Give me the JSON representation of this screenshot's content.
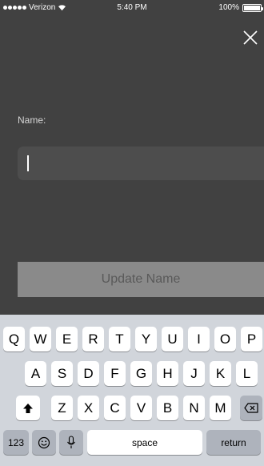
{
  "status_bar": {
    "carrier": "Verizon",
    "time": "5:40 PM",
    "battery": "100%",
    "battery_level": 1.0
  },
  "form": {
    "name_label": "Name:",
    "name_value": "",
    "submit_label": "Update Name"
  },
  "keyboard": {
    "row1": [
      "Q",
      "W",
      "E",
      "R",
      "T",
      "Y",
      "U",
      "I",
      "O",
      "P"
    ],
    "row2": [
      "A",
      "S",
      "D",
      "F",
      "G",
      "H",
      "J",
      "K",
      "L"
    ],
    "row3": [
      "Z",
      "X",
      "C",
      "V",
      "B",
      "N",
      "M"
    ],
    "numbers_label": "123",
    "space_label": "space",
    "return_label": "return"
  },
  "icons": {
    "close": "close-icon",
    "shift": "shift-icon",
    "backspace": "backspace-icon",
    "emoji": "emoji-icon",
    "mic": "microphone-icon",
    "wifi": "wifi-icon",
    "battery": "battery-icon"
  },
  "colors": {
    "background": "#414141",
    "input": "#4d4d4d",
    "button": "#8a8a8a",
    "keyboard": "#d1d5db"
  }
}
